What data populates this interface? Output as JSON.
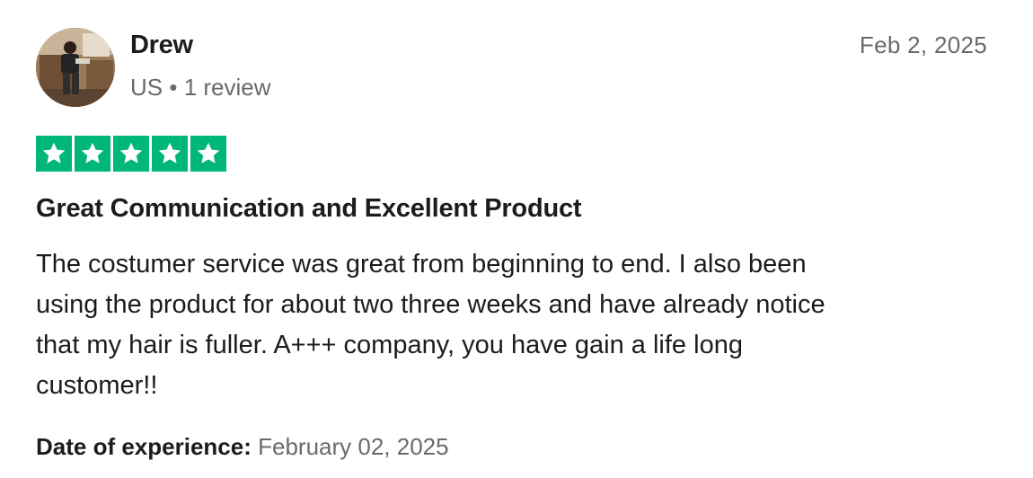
{
  "reviewer": {
    "name": "Drew",
    "country": "US",
    "separator": "•",
    "review_count": "1 review"
  },
  "review": {
    "date": "Feb 2, 2025",
    "rating": 5,
    "rating_max": 5,
    "star_color": "#00b67a",
    "title": "Great Communication and Excellent Product",
    "body_lines": [
      "The costumer service was great from beginning to end. I also been",
      "using the product for about two three weeks and have already notice",
      "that my hair is fuller. A+++ company, you have gain a life long",
      "customer!!"
    ],
    "experience_label": "Date of experience:",
    "experience_date": "February 02, 2025"
  }
}
